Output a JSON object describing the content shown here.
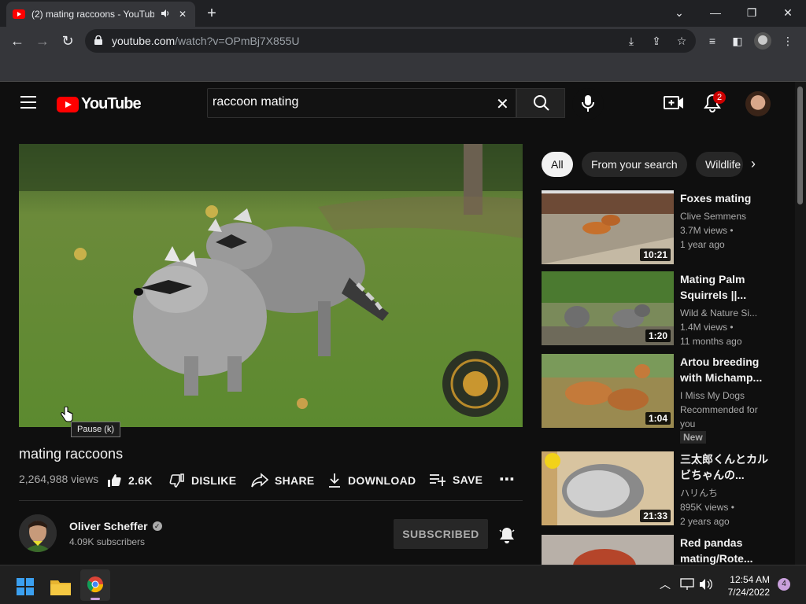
{
  "browser": {
    "tab_title": "(2) mating raccoons - YouTube",
    "url_host": "youtube.com",
    "url_path": "/watch?v=OPmBj7X855U"
  },
  "youtube": {
    "logo_text": "YouTube",
    "search_query": "raccoon mating",
    "notification_count": "2",
    "video": {
      "title": "mating raccoons",
      "views": "2,264,988 views",
      "likes": "2.6K",
      "dislike_label": "DISLIKE",
      "share_label": "SHARE",
      "download_label": "DOWNLOAD",
      "save_label": "SAVE",
      "tooltip": "Pause (k)"
    },
    "channel": {
      "name": "Oliver Scheffer",
      "subscribers": "4.09K subscribers",
      "subscribe_label": "SUBSCRIBED"
    },
    "chips": [
      "All",
      "From your search",
      "Wildlife"
    ],
    "recommendations": [
      {
        "title": "Foxes mating",
        "channel": "Clive Semmens",
        "views": "3.7M views •",
        "age": "1 year ago",
        "duration": "10:21",
        "badge": ""
      },
      {
        "title": "Mating Palm Squirrels ||...",
        "channel": "Wild & Nature Si...",
        "views": "1.4M views •",
        "age": "11 months ago",
        "duration": "1:20",
        "badge": ""
      },
      {
        "title": "Artou breeding with Michamp...",
        "channel": "I Miss My Dogs",
        "views": "Recommended for you",
        "age": "",
        "duration": "1:04",
        "badge": "New"
      },
      {
        "title": "三太郎くんとカルビちゃんの...",
        "channel": "ハリんち",
        "views": "895K views •",
        "age": "2 years ago",
        "duration": "21:33",
        "badge": ""
      },
      {
        "title": "Red pandas mating/Rote...",
        "channel": "",
        "views": "",
        "age": "",
        "duration": "",
        "badge": ""
      }
    ]
  },
  "taskbar": {
    "time": "12:54 AM",
    "date": "7/24/2022",
    "notification_count": "4"
  },
  "colors": {
    "youtube_red": "#ff0000",
    "page_bg": "#0f0f0f",
    "chrome_bg": "#35363a"
  }
}
